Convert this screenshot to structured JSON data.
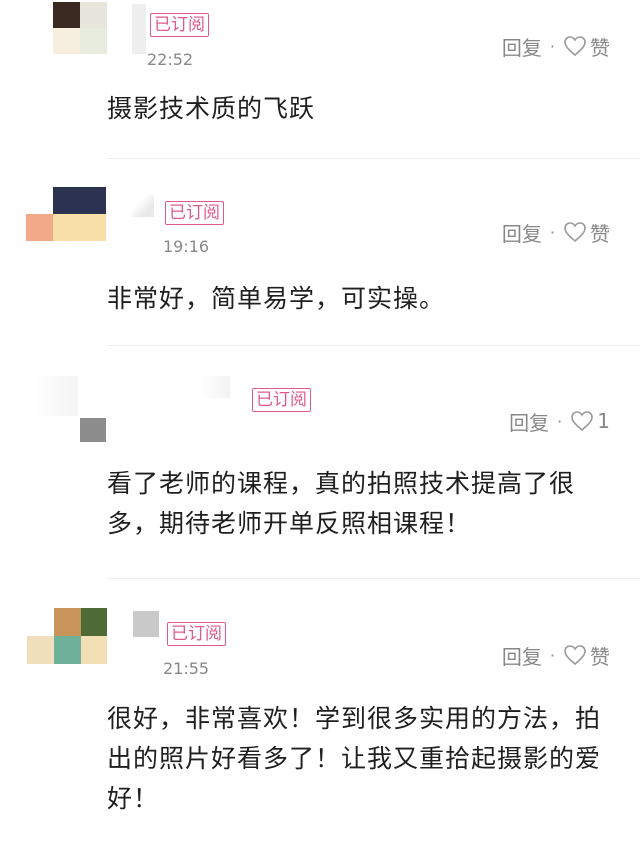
{
  "comments": [
    {
      "badge": "已订阅",
      "time": "22:52",
      "reply_label": "回复",
      "separator": "·",
      "like_label": "赞",
      "text": "摄影技术质的飞跃"
    },
    {
      "badge": "已订阅",
      "time": "19:16",
      "reply_label": "回复",
      "separator": "·",
      "like_label": "赞",
      "text": "非常好，简单易学，可实操。"
    },
    {
      "badge": "已订阅",
      "time": "",
      "reply_label": "回复",
      "separator": "·",
      "like_label": "1",
      "text": "看了老师的课程，真的拍照技术提高了很多，期待老师开单反照相课程！"
    },
    {
      "badge": "已订阅",
      "time": "21:55",
      "reply_label": "回复",
      "separator": "·",
      "like_label": "赞",
      "text": "很好，非常喜欢！学到很多实用的方法，拍出的照片好看多了！让我又重拾起摄影的爱好！"
    }
  ],
  "colors": {
    "badge": "#e05a8a",
    "meta": "#888888",
    "text": "#1f1f1f",
    "divider": "#eeeeee"
  },
  "icons": {
    "like": "heart-outline-icon"
  }
}
